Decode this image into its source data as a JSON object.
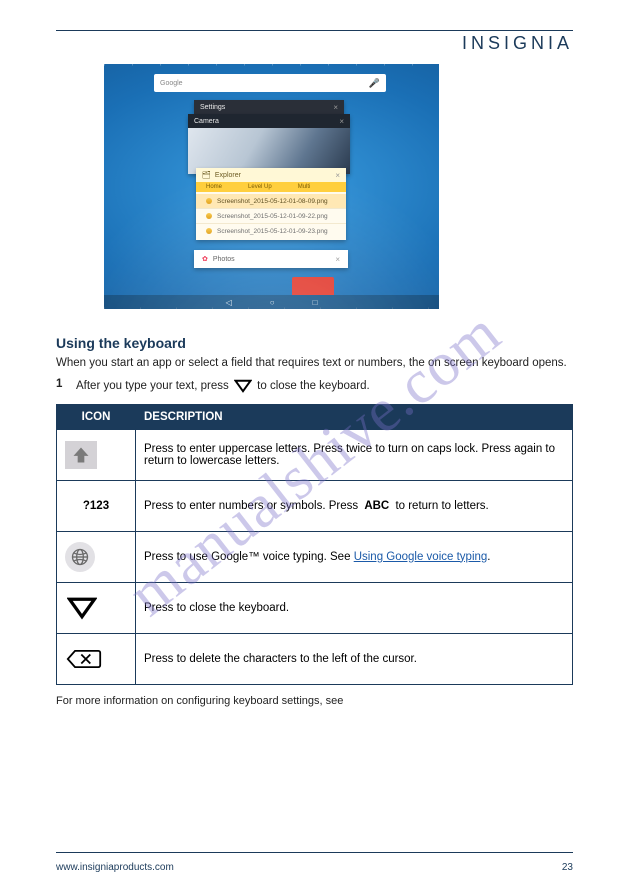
{
  "brand": "INSIGNIA",
  "watermark": "manualshive.com",
  "screenshot": {
    "search_placeholder": "Google",
    "windows": {
      "settings": "Settings",
      "camera": "Camera",
      "explorer": {
        "title": "Explorer",
        "tabs": [
          "Home",
          "Level Up",
          "Multi"
        ],
        "rows": [
          "Screenshot_2015-05-12-01-08-09.png",
          "Screenshot_2015-05-12-01-09-22.png",
          "Screenshot_2015-05-12-01-09-23.png"
        ]
      },
      "photos": "Photos"
    },
    "nav": [
      "◁",
      "○",
      "□"
    ]
  },
  "section_heading": "Using the keyboard",
  "para1": "When you start an app or select a field that requires text or numbers, the on screen keyboard opens.",
  "step1_num": "1",
  "step1_text": "After you type your text, press",
  "step1_tail": "to close the keyboard.",
  "table": {
    "headers": [
      "ICON",
      "DESCRIPTION"
    ],
    "rows": [
      {
        "desc_a": "Press to enter uppercase letters. Press twice to turn on caps lock. Press again to return to lowercase letters."
      },
      {
        "label": "?123",
        "desc_a": "Press to enter numbers or symbols. Press",
        "desc_b": "to return to letters.",
        "abc": "ABC"
      },
      {
        "desc_a": "Press to use Google™ voice typing. See",
        "link": "Using Google voice typing",
        "desc_b": "."
      },
      {
        "desc_a": "Press to close the keyboard."
      },
      {
        "desc_a": "Press to delete the characters to the left of the cursor."
      }
    ]
  },
  "more_info": "For more information on configuring keyboard settings, see",
  "footer_left": "www.insigniaproducts.com",
  "footer_right": "23"
}
